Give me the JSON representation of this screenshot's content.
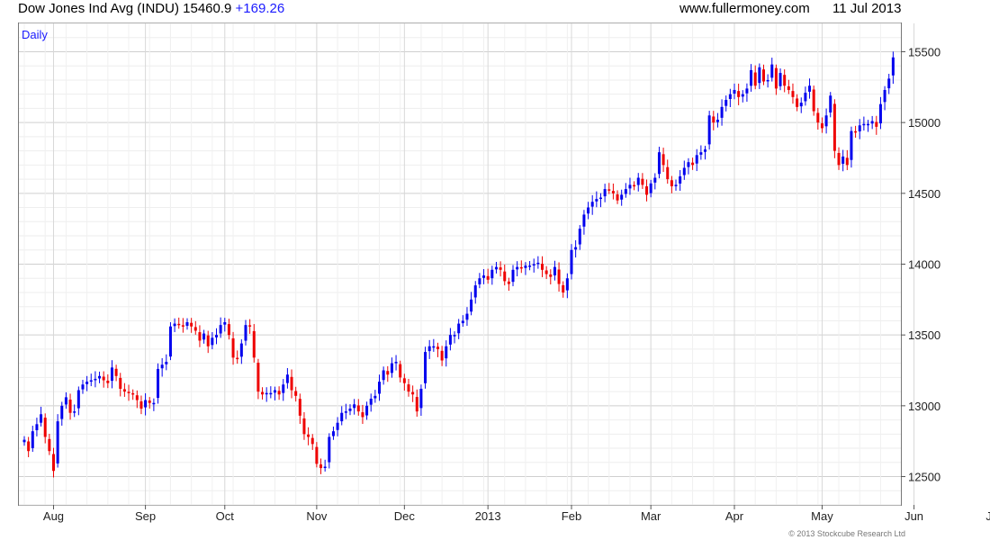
{
  "header": {
    "instrument": "Dow Jones Ind Avg (INDU)",
    "last": "15460.9",
    "change": "+169.26",
    "site": "www.fullermoney.com",
    "date": "11 Jul 2013"
  },
  "footer": {
    "copyright": "© 2013 Stockcube Research Ltd"
  },
  "colors": {
    "up": "#0000ee",
    "down": "#ee0000",
    "grid": "#dcdcdc",
    "frame": "#777777",
    "period_label": "#1a1aff"
  },
  "chart_data": {
    "type": "candlestick",
    "period": "Daily",
    "ylim": [
      12300,
      15700
    ],
    "y_ticks": [
      12500,
      13000,
      13500,
      14000,
      14500,
      15000,
      15500
    ],
    "y_axis_position": "right",
    "grid": true,
    "x_labels": [
      {
        "label": "Aug",
        "bar": 7
      },
      {
        "label": "Sep",
        "bar": 29
      },
      {
        "label": "Oct",
        "bar": 48
      },
      {
        "label": "Nov",
        "bar": 70
      },
      {
        "label": "Dec",
        "bar": 91
      },
      {
        "label": "2013",
        "bar": 111
      },
      {
        "label": "Feb",
        "bar": 131
      },
      {
        "label": "Mar",
        "bar": 150
      },
      {
        "label": "Apr",
        "bar": 170
      },
      {
        "label": "May",
        "bar": 191
      },
      {
        "label": "Jun",
        "bar": 213
      },
      {
        "label": "Jul",
        "bar": 232
      }
    ],
    "closes": [
      12760,
      12680,
      12820,
      12870,
      12940,
      12780,
      12680,
      12540,
      12890,
      13000,
      13060,
      12950,
      12960,
      13110,
      13150,
      13170,
      13180,
      13190,
      13210,
      13180,
      13160,
      13270,
      13210,
      13120,
      13100,
      13090,
      13080,
      13040,
      12980,
      13040,
      13020,
      13020,
      13260,
      13290,
      13310,
      13560,
      13580,
      13570,
      13560,
      13590,
      13560,
      13530,
      13460,
      13510,
      13420,
      13480,
      13500,
      13570,
      13590,
      13500,
      13340,
      13330,
      13440,
      13570,
      13560,
      13340,
      13100,
      13080,
      13090,
      13090,
      13110,
      13080,
      13150,
      13220,
      13110,
      13070,
      12930,
      12800,
      12780,
      12730,
      12590,
      12560,
      12570,
      12780,
      12820,
      12880,
      12950,
      12960,
      12980,
      13010,
      12960,
      12920,
      13000,
      13050,
      13070,
      13170,
      13250,
      13220,
      13300,
      13310,
      13200,
      13160,
      13100,
      13080,
      12960,
      13120,
      13380,
      13420,
      13420,
      13400,
      13320,
      13420,
      13500,
      13500,
      13580,
      13600,
      13650,
      13750,
      13850,
      13900,
      13920,
      13890,
      13960,
      13980,
      13960,
      13880,
      13860,
      13960,
      13980,
      13970,
      13990,
      13990,
      14000,
      14010,
      13960,
      13930,
      13910,
      13980,
      13860,
      13800,
      13900,
      14100,
      14120,
      14250,
      14350,
      14400,
      14440,
      14460,
      14470,
      14530,
      14520,
      14500,
      14450,
      14490,
      14530,
      14560,
      14550,
      14610,
      14560,
      14490,
      14570,
      14610,
      14790,
      14700,
      14600,
      14550,
      14560,
      14620,
      14680,
      14720,
      14700,
      14770,
      14790,
      14810,
      15050,
      15000,
      15020,
      15110,
      15160,
      15200,
      15230,
      15180,
      15200,
      15240,
      15370,
      15260,
      15390,
      15290,
      15300,
      15410,
      15240,
      15350,
      15260,
      15230,
      15180,
      15110,
      15140,
      15210,
      15260,
      15080,
      15000,
      14960,
      15050,
      15190,
      14800,
      14700,
      14760,
      14700,
      14940,
      14930,
      14980,
      14990,
      14990,
      15010,
      14970,
      15130,
      15230,
      15310,
      15460
    ],
    "ohlc_note": ""
  }
}
